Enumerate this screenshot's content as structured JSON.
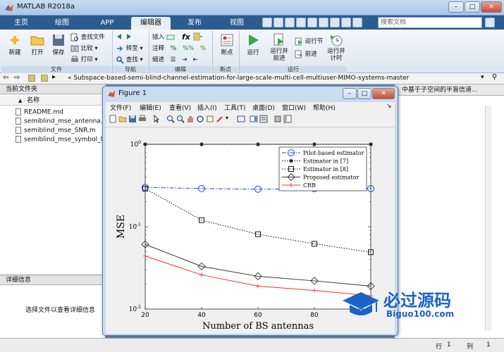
{
  "app": {
    "title": "MATLAB R2018a"
  },
  "tabs": [
    {
      "label": "主页"
    },
    {
      "label": "绘图"
    },
    {
      "label": "APP"
    },
    {
      "label": "编辑器"
    },
    {
      "label": "发布"
    },
    {
      "label": "视图"
    }
  ],
  "search": {
    "placeholder": "搜索文档"
  },
  "ribbon": {
    "file": {
      "new": "新建",
      "open": "打开",
      "save": "保存",
      "find_files": "查找文件",
      "compare": "比较",
      "print": "打印",
      "group": "文件"
    },
    "nav": {
      "goto": "转至",
      "find": "查找",
      "group": "导航"
    },
    "edit": {
      "insert": "插入",
      "comment": "注释",
      "indent": "缩进",
      "group": "编辑"
    },
    "breakpoints": {
      "label": "断点",
      "group": "断点"
    },
    "run": {
      "run": "运行",
      "run_advance": "运行并\n前进",
      "run_section": "运行节",
      "advance": "前进",
      "run_time": "运行并\n计时",
      "group": "运行"
    }
  },
  "path": {
    "text": "«  Subspace-based-semi-blind-channel-estimation-for-large-scale-multi-cell-multiuser-MIMO-systems-master"
  },
  "current_folder": {
    "header": "当前文件夹",
    "col_name": "名称",
    "sort_indicator": "▲",
    "files": [
      "README.md",
      "semiblind_mse_antenna.m",
      "semiblind_mse_SNR.m",
      "semiblind_mse_symbol_len"
    ]
  },
  "details": {
    "header": "详细信息",
    "hint": "选择文件以查看详细信息"
  },
  "command_window": {
    "header_text": "中基于子空间的半盲信道..."
  },
  "status": {
    "row_label": "行",
    "row_value": "1",
    "col_label": "列",
    "col_value": "1"
  },
  "figure": {
    "title": "Figure 1",
    "menu": [
      "文件(F)",
      "编辑(E)",
      "查看(V)",
      "插入(I)",
      "工具(T)",
      "桌面(D)",
      "窗口(W)",
      "帮助(H)"
    ]
  },
  "watermark": {
    "cn": "必过源码",
    "url": "Biguo100.com"
  },
  "chart_data": {
    "type": "line",
    "title": "",
    "xlabel": "Number of BS antennas",
    "ylabel": "MSE",
    "xlim": [
      20,
      100
    ],
    "ylim": [
      0.01,
      1
    ],
    "yscale": "log",
    "x_ticks": [
      "20",
      "40",
      "60",
      "80"
    ],
    "y_ticks": [
      {
        "base": "10",
        "exp": "0",
        "v": 1
      },
      {
        "base": "10",
        "exp": "-1",
        "v": 0.1
      },
      {
        "base": "10",
        "exp": "-2",
        "v": 0.01
      }
    ],
    "grid": false,
    "legend_position": "top-right",
    "x": [
      20,
      40,
      60,
      80,
      100
    ],
    "series": [
      {
        "name": "Pilot-based estimator",
        "color": "#1f3fff",
        "style": "dashdot",
        "marker": "circle",
        "values": [
          0.3,
          0.29,
          0.285,
          0.29,
          0.29
        ]
      },
      {
        "name": "Estimator in [7]",
        "color": "#000000",
        "style": "dotted",
        "marker": "star",
        "values": [
          1.0,
          1.0,
          1.0,
          1.0,
          1.0
        ]
      },
      {
        "name": "Estimator in [8]",
        "color": "#000000",
        "style": "dotted",
        "marker": "square",
        "values": [
          0.29,
          0.12,
          0.081,
          0.062,
          0.049
        ]
      },
      {
        "name": "Proposed estimator",
        "color": "#333333",
        "style": "solid",
        "marker": "diamond",
        "values": [
          0.061,
          0.033,
          0.025,
          0.022,
          0.019
        ]
      },
      {
        "name": "CRB",
        "color": "#ee3333",
        "style": "solid",
        "marker": "plus",
        "values": [
          0.044,
          0.026,
          0.019,
          0.0168,
          0.0145
        ]
      }
    ]
  }
}
